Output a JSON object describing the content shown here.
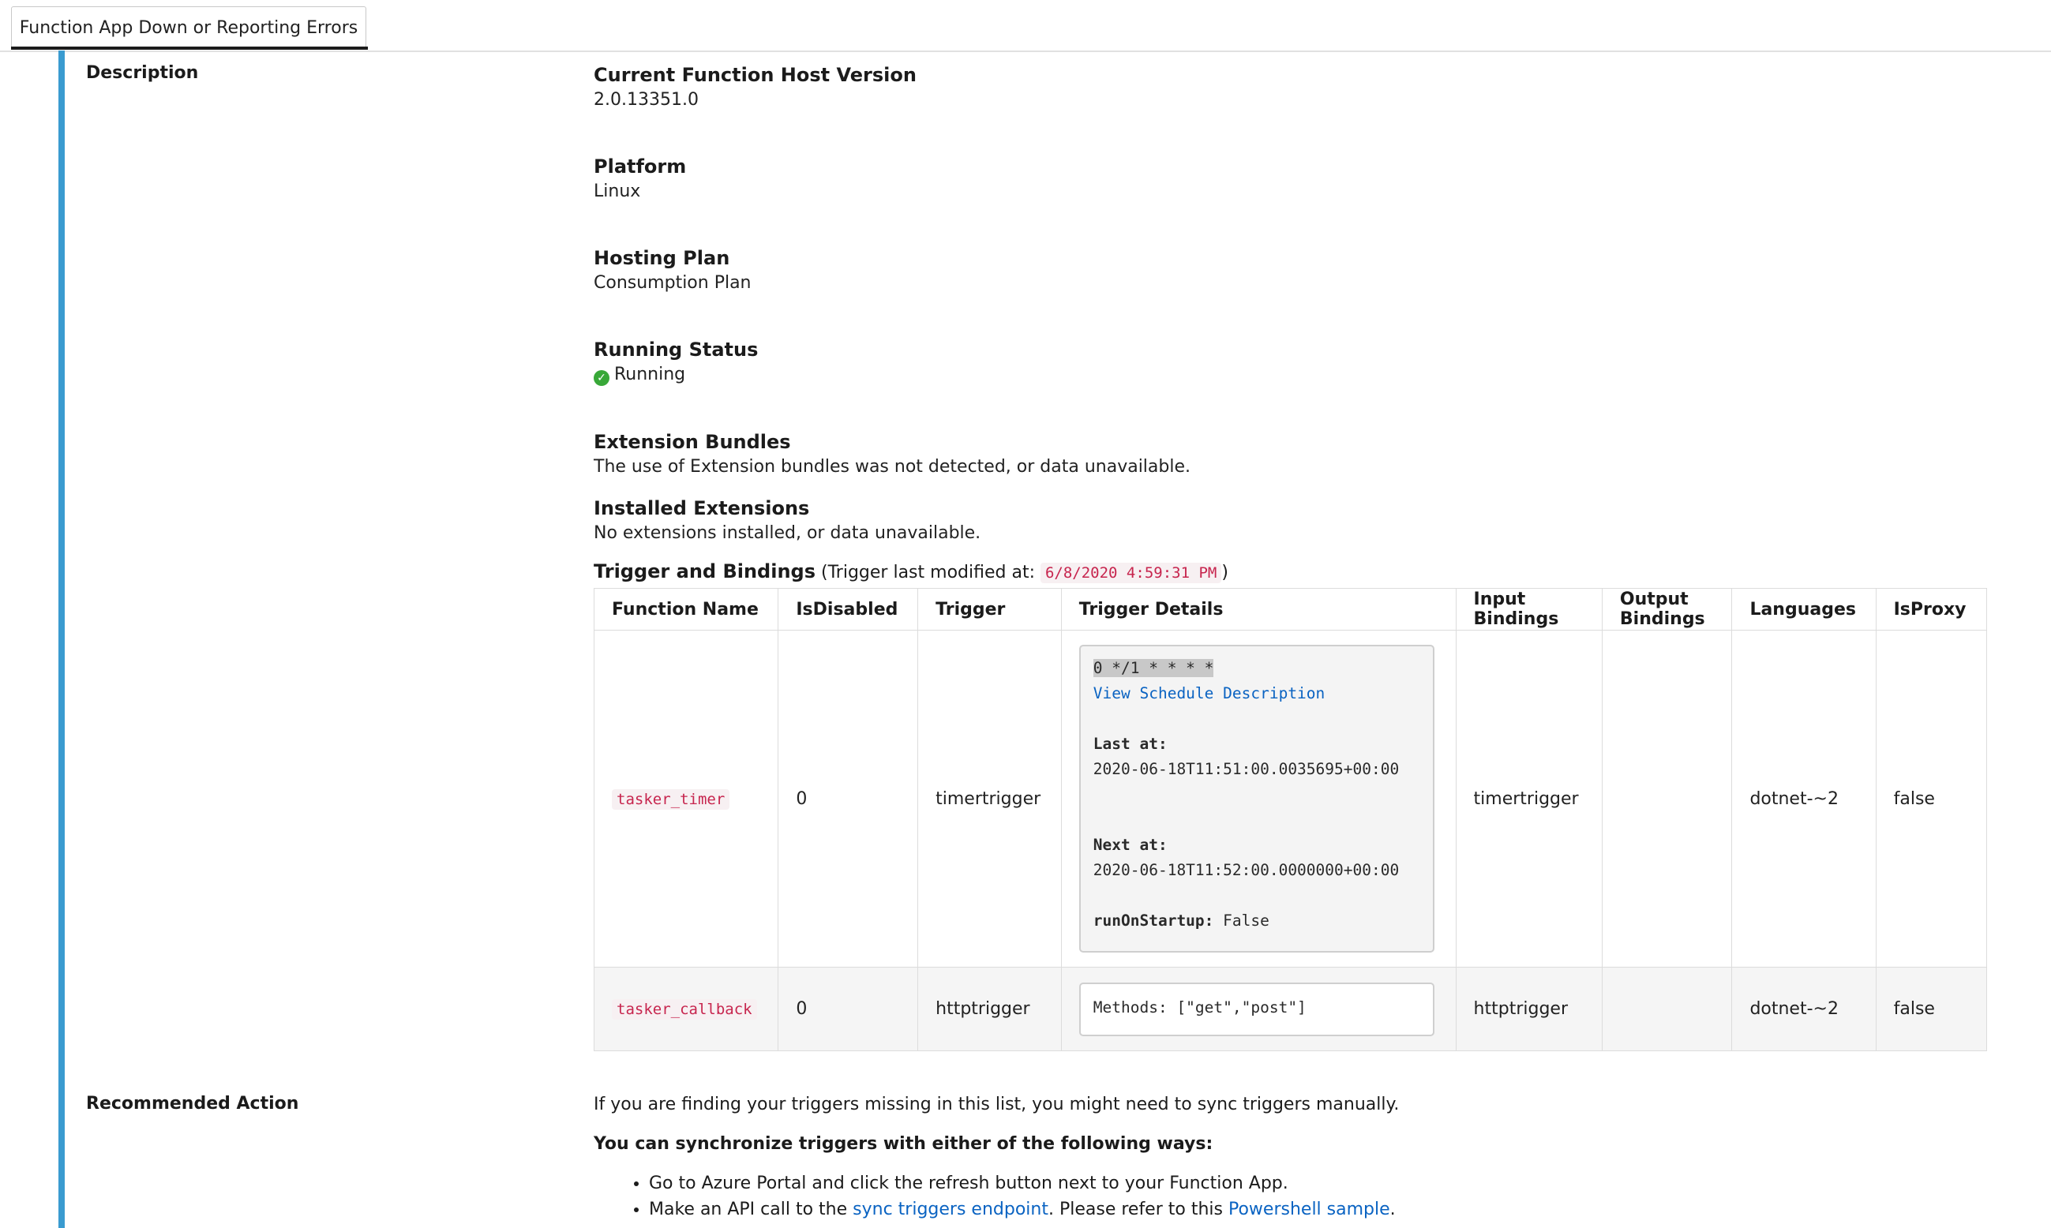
{
  "tab": {
    "label": "Function App Down or Reporting Errors"
  },
  "description": {
    "label": "Description",
    "properties": [
      {
        "title": "Current Function Host Version",
        "value": "2.0.13351.0"
      },
      {
        "title": "Platform",
        "value": "Linux"
      },
      {
        "title": "Hosting Plan",
        "value": "Consumption Plan"
      },
      {
        "title": "Running Status",
        "value": "Running",
        "icon": "check-circle-icon",
        "status_color": "#38a838"
      },
      {
        "title": "Extension Bundles",
        "value": "The use of Extension bundles was not detected, or data unavailable."
      },
      {
        "title": "Installed Extensions",
        "value": "No extensions installed, or data unavailable."
      }
    ],
    "triggers": {
      "title": "Trigger and Bindings",
      "modified_prefix": "(Trigger last modified at:",
      "modified_at": "6/8/2020 4:59:31 PM",
      "modified_suffix": ")",
      "columns": [
        "Function Name",
        "IsDisabled",
        "Trigger",
        "Trigger Details",
        "Input Bindings",
        "Output Bindings",
        "Languages",
        "IsProxy"
      ],
      "rows": [
        {
          "name": "tasker_timer",
          "is_disabled": "0",
          "trigger": "timertrigger",
          "details": {
            "schedule": "0 */1 * * * *",
            "schedule_link": "View Schedule Description",
            "last_label": "Last at:",
            "last_value": "2020-06-18T11:51:00.0035695+00:00",
            "next_label": "Next at:",
            "next_value": "2020-06-18T11:52:00.0000000+00:00",
            "startup_label": "runOnStartup:",
            "startup_value": "False"
          },
          "input_bindings": "timertrigger",
          "output_bindings": "",
          "languages": "dotnet-~2",
          "is_proxy": "false"
        },
        {
          "name": "tasker_callback",
          "is_disabled": "0",
          "trigger": "httptrigger",
          "details": {
            "methods": "Methods: [\"get\",\"post\"]"
          },
          "input_bindings": "httptrigger",
          "output_bindings": "",
          "languages": "dotnet-~2",
          "is_proxy": "false"
        }
      ]
    }
  },
  "recommended": {
    "label": "Recommended Action",
    "intro": "If you are finding your triggers missing in this list, you might need to sync triggers manually.",
    "ways_heading": "You can synchronize triggers with either of the following ways:",
    "way1": "Go to Azure Portal and click the refresh button next to your Function App.",
    "way2_prefix": "Make an API call to the",
    "way2_link1": "sync triggers endpoint",
    "way2_middle": ". Please refer to this",
    "way2_link2": "Powershell sample",
    "way2_suffix": "."
  },
  "colors": {
    "accent": "#3a9bd0",
    "link": "#0a63c2",
    "code": "#c7254e"
  }
}
